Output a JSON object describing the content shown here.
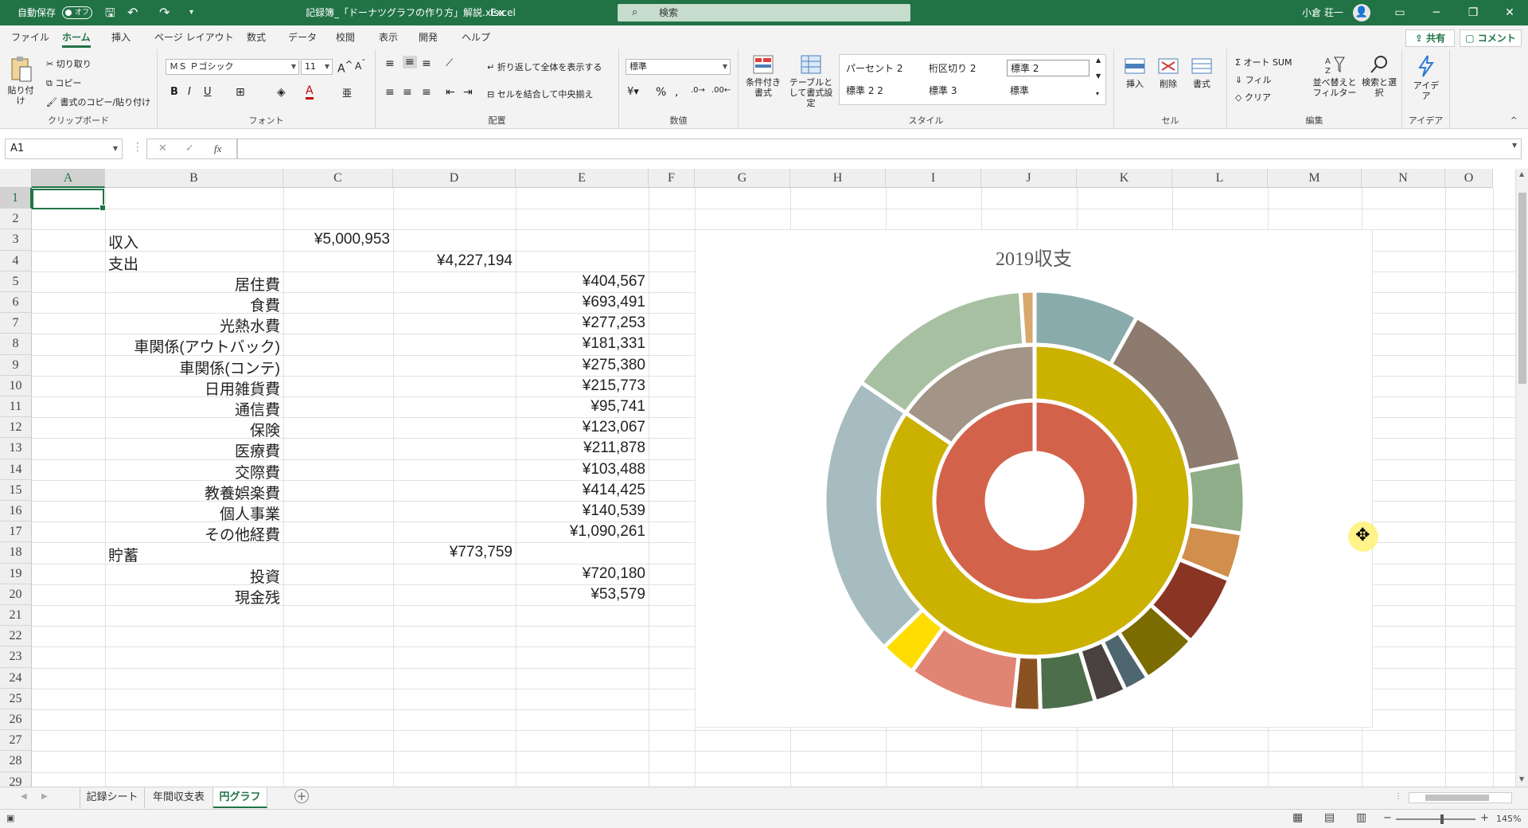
{
  "titlebar": {
    "autosave_label": "自動保存",
    "autosave_state": "オフ",
    "filename": "記録簿_「ドーナツグラフの作り方」解説.xlsx",
    "separator": "-",
    "app": "Excel",
    "search_placeholder": "検索",
    "user": "小倉 荘一"
  },
  "menu": {
    "tabs": [
      "ファイル",
      "ホーム",
      "挿入",
      "ページ レイアウト",
      "数式",
      "データ",
      "校閲",
      "表示",
      "開発",
      "ヘルプ"
    ],
    "active": "ホーム",
    "share": "共有",
    "comment": "コメント"
  },
  "ribbon": {
    "clipboard": {
      "paste": "貼り付け",
      "cut": "切り取り",
      "copy": "コピー",
      "format_painter": "書式のコピー/貼り付け",
      "label": "クリップボード"
    },
    "font": {
      "name": "ＭＳ Ｐゴシック",
      "size": "11",
      "label": "フォント"
    },
    "alignment": {
      "wrap": "折り返して全体を表示する",
      "merge": "セルを結合して中央揃え",
      "label": "配置"
    },
    "number": {
      "format": "標準",
      "label": "数値"
    },
    "styles": {
      "conditional": "条件付き書式",
      "as_table": "テーブルとして書式設定",
      "gallery": [
        "パーセント 2",
        "桁区切り 2",
        "標準 2",
        "標準 2 2",
        "標準 3",
        "標準"
      ],
      "selected": "標準 2",
      "label": "スタイル"
    },
    "cells": {
      "insert": "挿入",
      "delete": "削除",
      "format": "書式",
      "label": "セル"
    },
    "editing": {
      "autosum": "オート SUM",
      "fill": "フィル",
      "clear": "クリア",
      "sort": "並べ替えとフィルター",
      "find": "検索と選択",
      "label": "編集"
    },
    "ideas": {
      "btn": "アイデア",
      "label": "アイデア"
    }
  },
  "formula": {
    "namebox": "A1",
    "fx": "fx",
    "cancel": "✕",
    "enter": "✓",
    "value": ""
  },
  "grid": {
    "columns": [
      "A",
      "B",
      "C",
      "D",
      "E",
      "F",
      "G",
      "H",
      "I",
      "J",
      "K",
      "L",
      "M",
      "N",
      "O"
    ],
    "rows": [
      "1",
      "2",
      "3",
      "4",
      "5",
      "6",
      "7",
      "8",
      "9",
      "10",
      "11",
      "12",
      "13",
      "14",
      "15",
      "16",
      "17",
      "18",
      "19",
      "20",
      "21",
      "22",
      "23",
      "24",
      "25",
      "26",
      "27",
      "28",
      "29"
    ],
    "selected_cell": "A1",
    "cells": [
      {
        "row": 3,
        "col": "B",
        "text": "収入",
        "align": "left"
      },
      {
        "row": 3,
        "col": "C",
        "text": "¥5,000,953",
        "align": "right"
      },
      {
        "row": 4,
        "col": "B",
        "text": "支出",
        "align": "left"
      },
      {
        "row": 4,
        "col": "D",
        "text": "¥4,227,194",
        "align": "right"
      },
      {
        "row": 5,
        "col": "B",
        "text": "居住費",
        "align": "right"
      },
      {
        "row": 5,
        "col": "E",
        "text": "¥404,567",
        "align": "right"
      },
      {
        "row": 6,
        "col": "B",
        "text": "食費",
        "align": "right"
      },
      {
        "row": 6,
        "col": "E",
        "text": "¥693,491",
        "align": "right"
      },
      {
        "row": 7,
        "col": "B",
        "text": "光熱水費",
        "align": "right"
      },
      {
        "row": 7,
        "col": "E",
        "text": "¥277,253",
        "align": "right"
      },
      {
        "row": 8,
        "col": "B",
        "text": "車関係(アウトバック)",
        "align": "right"
      },
      {
        "row": 8,
        "col": "E",
        "text": "¥181,331",
        "align": "right"
      },
      {
        "row": 9,
        "col": "B",
        "text": "車関係(コンテ)",
        "align": "right"
      },
      {
        "row": 9,
        "col": "E",
        "text": "¥275,380",
        "align": "right"
      },
      {
        "row": 10,
        "col": "B",
        "text": "日用雑貨費",
        "align": "right"
      },
      {
        "row": 10,
        "col": "E",
        "text": "¥215,773",
        "align": "right"
      },
      {
        "row": 11,
        "col": "B",
        "text": "通信費",
        "align": "right"
      },
      {
        "row": 11,
        "col": "E",
        "text": "¥95,741",
        "align": "right"
      },
      {
        "row": 12,
        "col": "B",
        "text": "保険",
        "align": "right"
      },
      {
        "row": 12,
        "col": "E",
        "text": "¥123,067",
        "align": "right"
      },
      {
        "row": 13,
        "col": "B",
        "text": "医療費",
        "align": "right"
      },
      {
        "row": 13,
        "col": "E",
        "text": "¥211,878",
        "align": "right"
      },
      {
        "row": 14,
        "col": "B",
        "text": "交際費",
        "align": "right"
      },
      {
        "row": 14,
        "col": "E",
        "text": "¥103,488",
        "align": "right"
      },
      {
        "row": 15,
        "col": "B",
        "text": "教養娯楽費",
        "align": "right"
      },
      {
        "row": 15,
        "col": "E",
        "text": "¥414,425",
        "align": "right"
      },
      {
        "row": 16,
        "col": "B",
        "text": "個人事業",
        "align": "right"
      },
      {
        "row": 16,
        "col": "E",
        "text": "¥140,539",
        "align": "right"
      },
      {
        "row": 17,
        "col": "B",
        "text": "その他経費",
        "align": "right"
      },
      {
        "row": 17,
        "col": "E",
        "text": "¥1,090,261",
        "align": "right"
      },
      {
        "row": 18,
        "col": "B",
        "text": "貯蓄",
        "align": "left"
      },
      {
        "row": 18,
        "col": "D",
        "text": "¥773,759",
        "align": "right"
      },
      {
        "row": 19,
        "col": "B",
        "text": "投資",
        "align": "right"
      },
      {
        "row": 19,
        "col": "E",
        "text": "¥720,180",
        "align": "right"
      },
      {
        "row": 20,
        "col": "B",
        "text": "現金残",
        "align": "right"
      },
      {
        "row": 20,
        "col": "E",
        "text": "¥53,579",
        "align": "right"
      }
    ]
  },
  "chart_data": {
    "type": "donut",
    "title": "2019収支",
    "rings": [
      {
        "values": [
          5000953
        ],
        "colors": [
          "#d2634a"
        ]
      },
      {
        "values": [
          4227194,
          773759
        ],
        "colors": [
          "#cbb100",
          "#a29486"
        ]
      },
      {
        "values": [
          404567,
          693491,
          277253,
          181331,
          275380,
          215773,
          95741,
          123067,
          211878,
          103488,
          414425,
          140539,
          1090261,
          720180,
          53579
        ],
        "colors": [
          "#8aabab",
          "#8c7b6e",
          "#8fad88",
          "#d08f4c",
          "#8a3424",
          "#7a6c00",
          "#4e6670",
          "#4a4141",
          "#4d6e4b",
          "#8a5223",
          "#e08574",
          "#ffdd00",
          "#a6bcc0",
          "#a7c0a2",
          "#d8a86f"
        ]
      }
    ]
  },
  "sheets": {
    "tabs": [
      "記録シート",
      "年間収支表",
      "円グラフ"
    ],
    "active": "円グラフ",
    "add": "+"
  },
  "status": {
    "zoom": "145%"
  }
}
